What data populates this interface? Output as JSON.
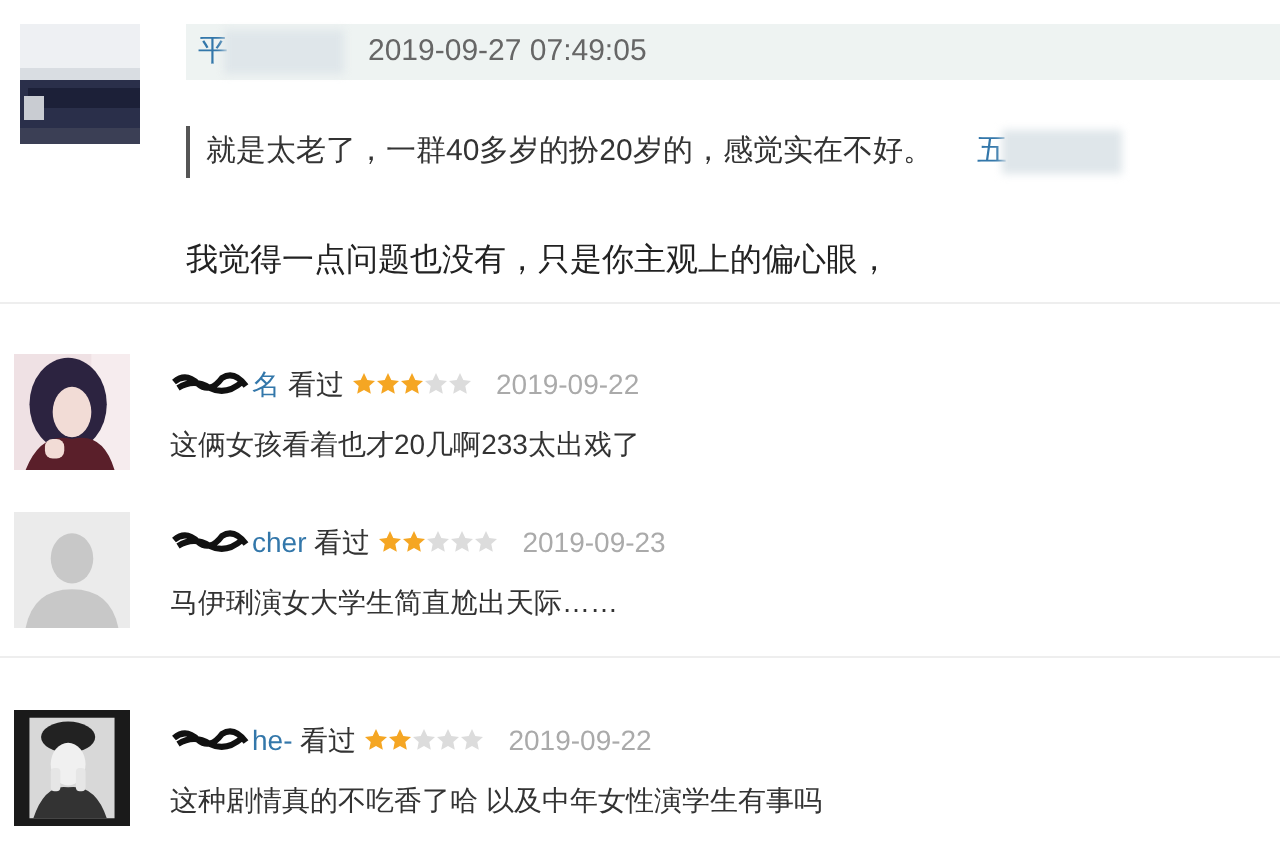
{
  "reply": {
    "user": "平",
    "name_obscured": true,
    "time": "2019-09-27 07:49:05",
    "quote": {
      "text": "就是太老了，一群40多岁的扮20岁的，感觉实在不好。",
      "user": "五",
      "name_obscured": true
    },
    "text": "我觉得一点问题也没有，只是你主观上的偏心眼，"
  },
  "comments": [
    {
      "user": "名",
      "name_obscured": true,
      "status": "看过",
      "stars": 3,
      "date": "2019-09-22",
      "text": "这俩女孩看着也才20几啊233太出戏了"
    },
    {
      "avatar": {
        "kind": "default"
      },
      "user": "cher",
      "name_obscured": true,
      "status": "看过",
      "stars": 2,
      "date": "2019-09-23",
      "text": "马伊琍演女大学生简直尬出天际……"
    },
    {
      "user": "he-",
      "name_obscured": true,
      "status": "看过",
      "stars": 2,
      "date": "2019-09-22",
      "text": "这种剧情真的不吃香了哈 以及中年女性演学生有事吗"
    }
  ]
}
